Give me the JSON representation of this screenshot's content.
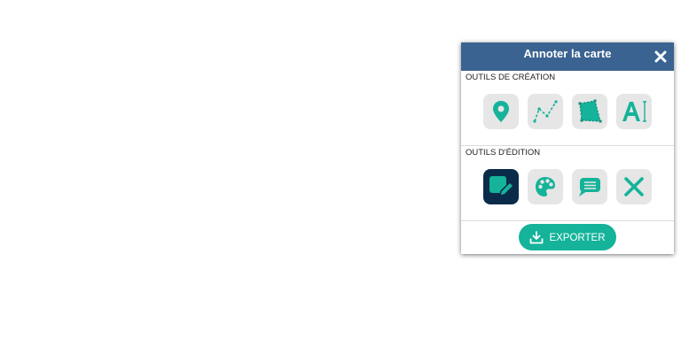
{
  "panel": {
    "title": "Annoter la carte",
    "close_icon": "close-icon"
  },
  "creation": {
    "label": "OUTILS DE CRÉATION",
    "tools": [
      {
        "icon": "map-marker-icon"
      },
      {
        "icon": "polyline-icon"
      },
      {
        "icon": "polygon-icon"
      },
      {
        "icon": "text-tool-icon"
      }
    ]
  },
  "edition": {
    "label": "OUTILS D'ÉDITION",
    "tools": [
      {
        "icon": "edit-shape-icon",
        "active": true
      },
      {
        "icon": "palette-icon"
      },
      {
        "icon": "comment-icon"
      },
      {
        "icon": "delete-icon"
      }
    ]
  },
  "export": {
    "label": "EXPORTER",
    "icon": "download-icon"
  },
  "colors": {
    "header": "#3a6391",
    "accent": "#14b39a",
    "tool_bg": "#e6e6e6",
    "active_bg": "#0b2b4a"
  }
}
